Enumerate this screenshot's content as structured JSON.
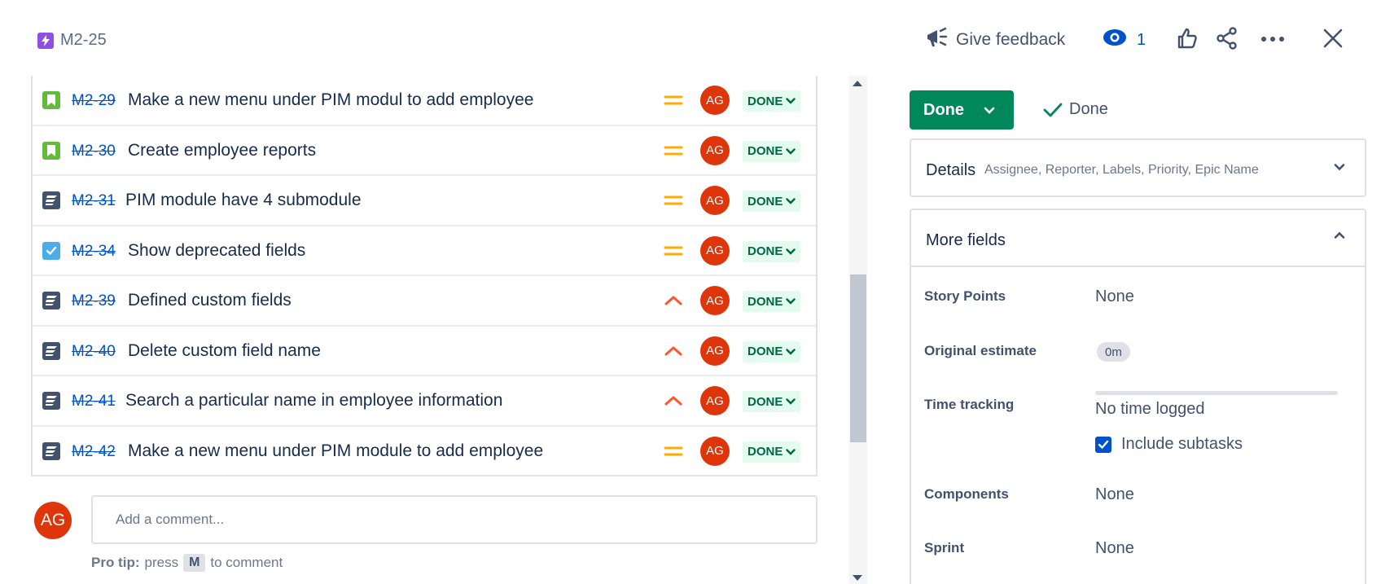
{
  "header": {
    "issue_key": "M2-25",
    "feedback_label": "Give feedback",
    "watch_count": "1"
  },
  "rows": [
    {
      "type": "story",
      "key": "M2-29",
      "summary": "Make a new menu under PIM modul to add employee",
      "priority": "medium",
      "assignee": "AG",
      "status": "DONE"
    },
    {
      "type": "story",
      "key": "M2-30",
      "summary": "Create employee reports",
      "priority": "medium",
      "assignee": "AG",
      "status": "DONE"
    },
    {
      "type": "feature",
      "key": "M2-31",
      "summary": "PIM module have 4 submodule",
      "priority": "medium",
      "assignee": "AG",
      "status": "DONE"
    },
    {
      "type": "task",
      "key": "M2-34",
      "summary": "Show deprecated fields",
      "priority": "medium",
      "assignee": "AG",
      "status": "DONE"
    },
    {
      "type": "feature",
      "key": "M2-39",
      "summary": "Defined custom fields",
      "priority": "high",
      "assignee": "AG",
      "status": "DONE"
    },
    {
      "type": "feature",
      "key": "M2-40",
      "summary": "Delete custom field name",
      "priority": "high",
      "assignee": "AG",
      "status": "DONE"
    },
    {
      "type": "feature",
      "key": "M2-41",
      "summary": "Search a particular name in employee information",
      "priority": "high",
      "assignee": "AG",
      "status": "DONE"
    },
    {
      "type": "feature",
      "key": "M2-42",
      "summary": "Make a new menu under PIM module to add employee",
      "priority": "medium",
      "assignee": "AG",
      "status": "DONE"
    }
  ],
  "comment": {
    "avatar": "AG",
    "placeholder": "Add a comment...",
    "protip_bold": "Pro tip:",
    "protip_press": "press",
    "protip_key": "M",
    "protip_tail": "to comment"
  },
  "sidebar": {
    "status_button": "Done",
    "resolution": "Done",
    "details_title": "Details",
    "details_sub": "Assignee, Reporter, Labels, Priority, Epic Name",
    "more_fields_title": "More fields",
    "fields": {
      "story_points_label": "Story Points",
      "story_points_value": "None",
      "original_estimate_label": "Original estimate",
      "original_estimate_value": "0m",
      "time_tracking_label": "Time tracking",
      "time_tracking_value": "No time logged",
      "include_subtasks_label": "Include subtasks",
      "components_label": "Components",
      "components_value": "None",
      "sprint_label": "Sprint",
      "sprint_value": "None"
    }
  },
  "colors": {
    "done_green": "#00875a",
    "link_blue": "#0052cc",
    "avatar_red": "#de350b",
    "priority_medium": "#ffab00",
    "priority_high": "#ff5630"
  }
}
